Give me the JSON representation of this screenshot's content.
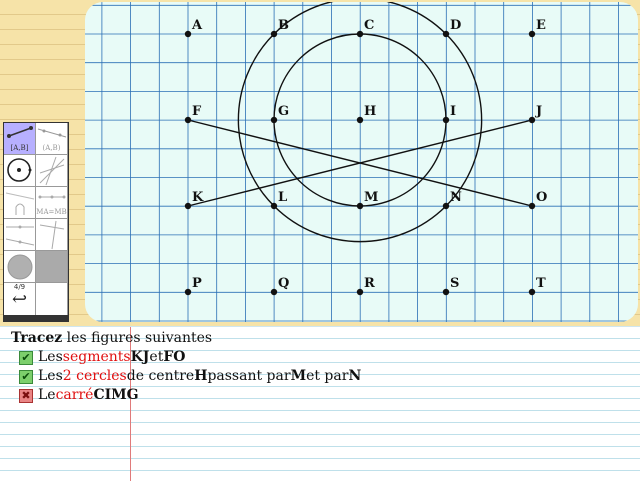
{
  "exercise": {
    "points": [
      {
        "label": "A",
        "col": 0,
        "row": 0
      },
      {
        "label": "B",
        "col": 1,
        "row": 0
      },
      {
        "label": "C",
        "col": 2,
        "row": 0
      },
      {
        "label": "D",
        "col": 3,
        "row": 0
      },
      {
        "label": "E",
        "col": 4,
        "row": 0
      },
      {
        "label": "F",
        "col": 0,
        "row": 1
      },
      {
        "label": "G",
        "col": 1,
        "row": 1
      },
      {
        "label": "H",
        "col": 2,
        "row": 1
      },
      {
        "label": "I",
        "col": 3,
        "row": 1
      },
      {
        "label": "J",
        "col": 4,
        "row": 1
      },
      {
        "label": "K",
        "col": 0,
        "row": 2
      },
      {
        "label": "L",
        "col": 1,
        "row": 2
      },
      {
        "label": "M",
        "col": 2,
        "row": 2
      },
      {
        "label": "N",
        "col": 3,
        "row": 2
      },
      {
        "label": "O",
        "col": 4,
        "row": 2
      },
      {
        "label": "P",
        "col": 0,
        "row": 3
      },
      {
        "label": "Q",
        "col": 1,
        "row": 3
      },
      {
        "label": "R",
        "col": 2,
        "row": 3
      },
      {
        "label": "S",
        "col": 3,
        "row": 3
      },
      {
        "label": "T",
        "col": 4,
        "row": 3
      }
    ],
    "segments": [
      [
        "K",
        "J"
      ],
      [
        "F",
        "O"
      ]
    ],
    "circles": [
      {
        "center": "H",
        "through": "M"
      },
      {
        "center": "H",
        "through": "N"
      }
    ]
  },
  "toolbox": {
    "tools": [
      {
        "name": "segment-tool",
        "label": "[A,B]",
        "active": true
      },
      {
        "name": "line-tool",
        "label": "(A,B)",
        "active": false
      },
      {
        "name": "circle-tool",
        "label": "",
        "active": false
      },
      {
        "name": "multi-line-tool",
        "label": "",
        "active": false
      },
      {
        "name": "arc-tool",
        "label": "",
        "active": false
      },
      {
        "name": "midpoint-tool",
        "label": "MA=MB",
        "active": false
      },
      {
        "name": "ruler-tool",
        "label": "",
        "active": false
      },
      {
        "name": "angle-tool",
        "label": "",
        "active": false
      },
      {
        "name": "fill-color-tool",
        "label": "",
        "active": false
      },
      {
        "name": "grey-fill-tool",
        "label": "",
        "active": false
      }
    ],
    "page_counter": "4/9",
    "back_icon": "return-arrow-icon"
  },
  "instructions": {
    "heading_bold": "Tracez",
    "heading_rest": " les figures suivantes",
    "tasks": [
      {
        "status": "done",
        "prefix": "Les ",
        "keyword": "segments",
        "middle": " ",
        "names1": "KJ",
        "join": " et ",
        "names2": "FO",
        "suffix": ""
      },
      {
        "status": "done",
        "prefix": "Les ",
        "keyword": "2 cercles",
        "middle": " de centre ",
        "names1": "H",
        "join": " passant par ",
        "names2": "M",
        "join2": " et par ",
        "names3": "N"
      },
      {
        "status": "failed",
        "prefix": "Le ",
        "keyword": "carré",
        "middle": " ",
        "names1": "CIMG"
      }
    ]
  },
  "colors": {
    "paper": "#f6e3a8",
    "canvas": "#e8fbf7",
    "grid_line": "#2a6fb5",
    "keyword_red": "#e01010",
    "check_green": "#7ccf6c",
    "cross_red": "#e98585",
    "active_tool": "#b7b0ff"
  }
}
